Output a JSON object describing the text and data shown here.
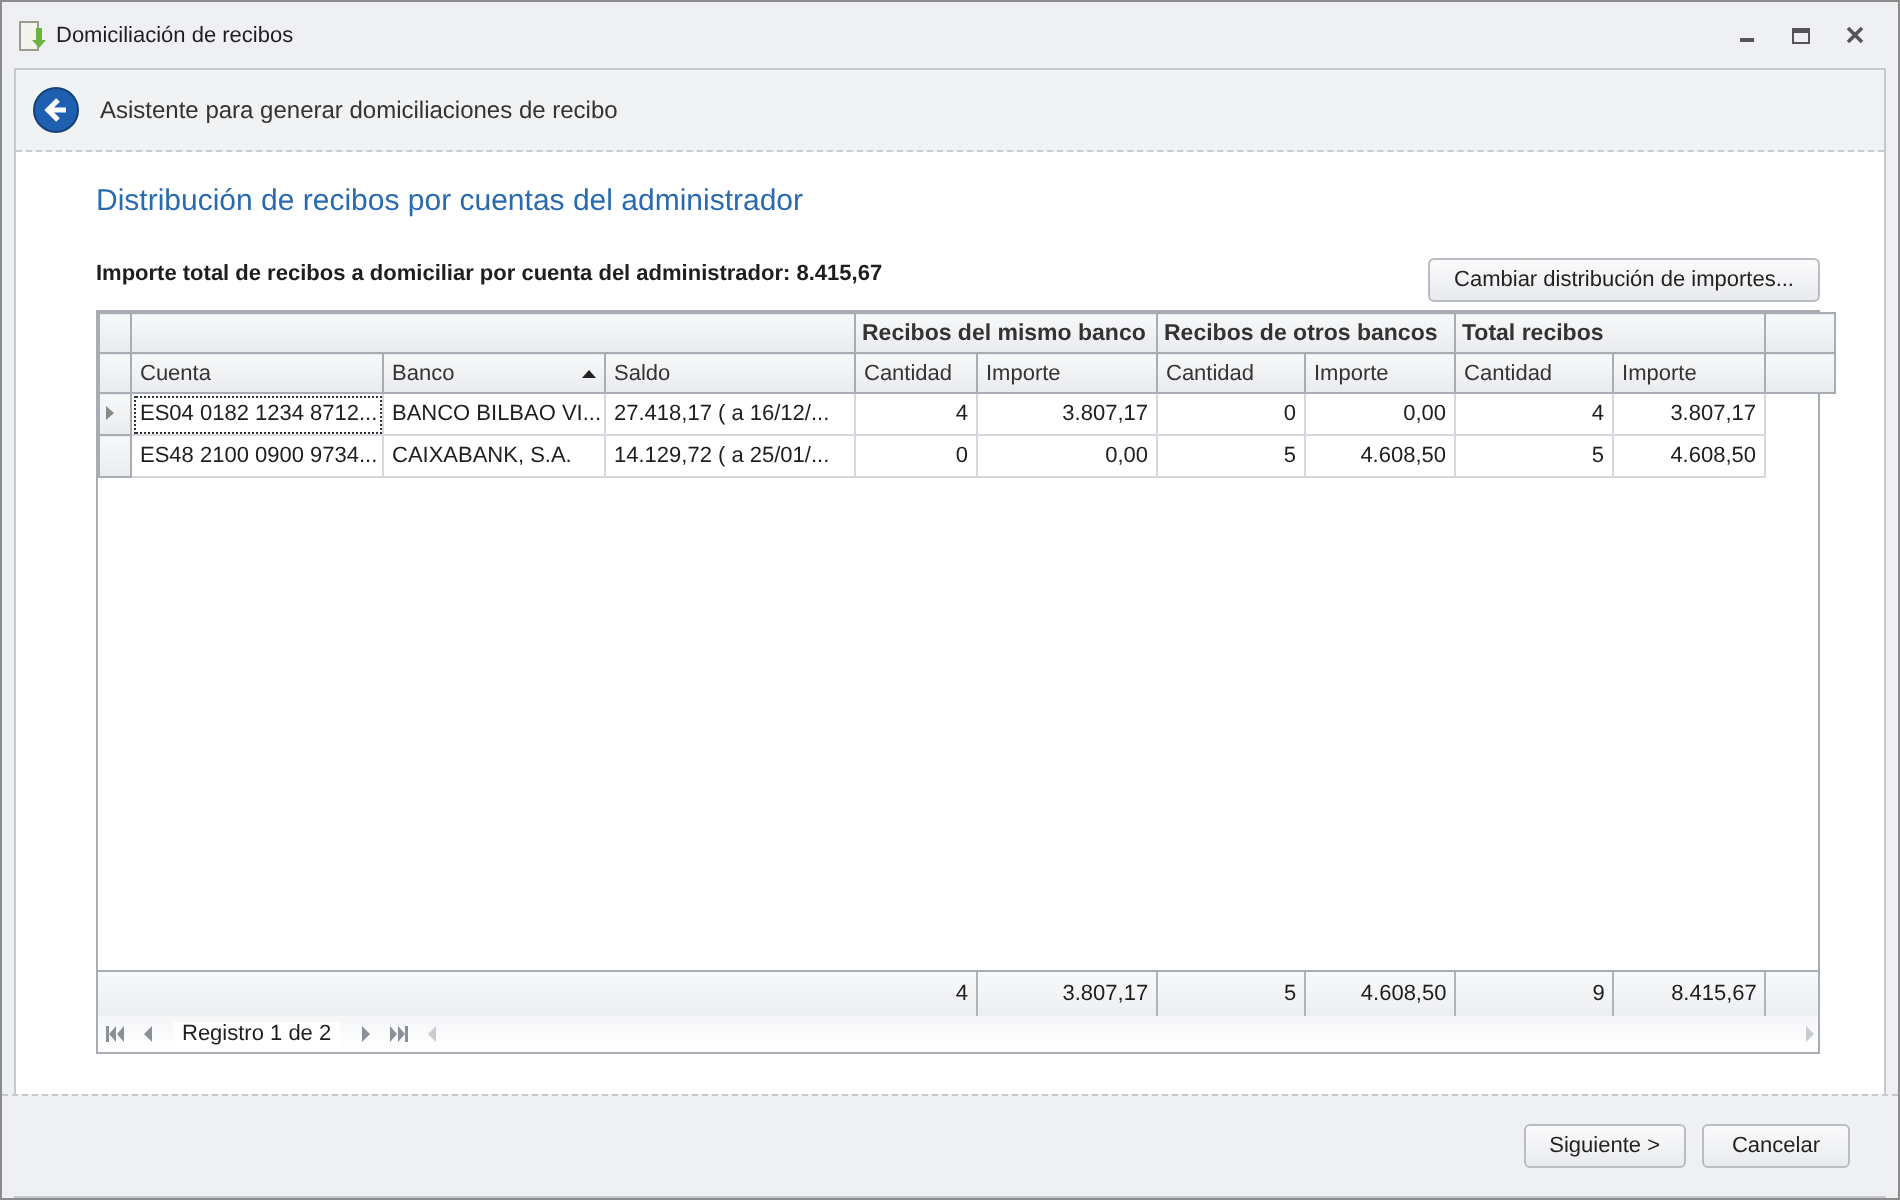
{
  "window": {
    "title": "Domiciliación de recibos"
  },
  "wizard_header": {
    "title": "Asistente para generar domiciliaciones de recibo"
  },
  "page_title": "Distribución de recibos por cuentas del administrador",
  "total_label": "Importe total de recibos a domiciliar por cuenta del administrador: 8.415,67",
  "change_button": "Cambiar distribución de importes...",
  "grid": {
    "bands": [
      "Recibos del mismo banco",
      "Recibos de otros bancos",
      "Total recibos"
    ],
    "columns": [
      {
        "label": "Cuenta",
        "sorted": false
      },
      {
        "label": "Banco",
        "sorted": true
      },
      {
        "label": "Saldo",
        "sorted": false
      },
      {
        "label": "Cantidad",
        "sorted": false
      },
      {
        "label": "Importe",
        "sorted": false
      },
      {
        "label": "Cantidad",
        "sorted": false
      },
      {
        "label": "Importe",
        "sorted": false
      },
      {
        "label": "Cantidad",
        "sorted": false
      },
      {
        "label": "Importe",
        "sorted": false
      }
    ],
    "rows": [
      {
        "selected": true,
        "cells": [
          "ES04 0182 1234 8712...",
          "BANCO BILBAO VI...",
          "27.418,17 ( a 16/12/...",
          "4",
          "3.807,17",
          "0",
          "0,00",
          "4",
          "3.807,17"
        ]
      },
      {
        "selected": false,
        "cells": [
          "ES48 2100 0900 9734...",
          "CAIXABANK, S.A.",
          "14.129,72 ( a 25/01/...",
          "0",
          "0,00",
          "5",
          "4.608,50",
          "5",
          "4.608,50"
        ]
      }
    ],
    "totals": [
      "4",
      "3.807,17",
      "5",
      "4.608,50",
      "9",
      "8.415,67"
    ],
    "navigator": "Registro 1 de 2"
  },
  "buttons": [
    "Siguiente >",
    "Cancelar"
  ]
}
